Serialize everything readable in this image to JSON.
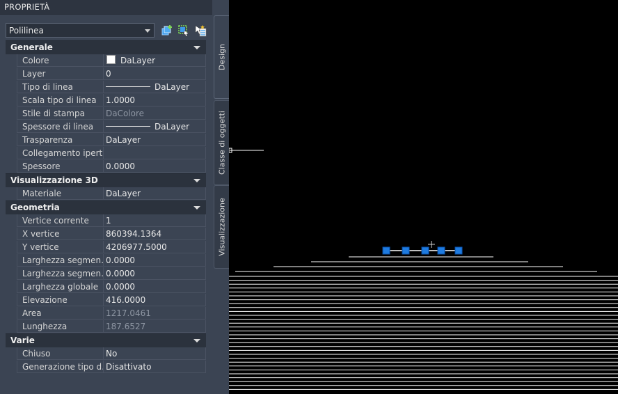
{
  "panel": {
    "title": "PROPRIETÀ",
    "object_selector": {
      "value": "Polilinea"
    },
    "toolbar": [
      {
        "name": "toggle-pickadd-icon"
      },
      {
        "name": "select-objects-icon"
      },
      {
        "name": "quick-select-icon"
      }
    ],
    "tabs": [
      {
        "label": "Design",
        "active": true
      },
      {
        "label": "Classe di oggetti",
        "active": false
      },
      {
        "label": "Visualizzazione",
        "active": false
      }
    ],
    "sections": [
      {
        "title": "Generale",
        "rows": [
          {
            "label": "Colore",
            "value": "DaLayer",
            "kind": "color",
            "swatch": "#ffffff"
          },
          {
            "label": "Layer",
            "value": "0"
          },
          {
            "label": "Tipo di linea",
            "value": "DaLayer",
            "kind": "line"
          },
          {
            "label": "Scala tipo di linea",
            "value": "1.0000"
          },
          {
            "label": "Stile di stampa",
            "value": "DaColore",
            "dim": true
          },
          {
            "label": "Spessore di linea",
            "value": "DaLayer",
            "kind": "line"
          },
          {
            "label": "Trasparenza",
            "value": "DaLayer"
          },
          {
            "label": "Collegamento  ipert…",
            "value": ""
          },
          {
            "label": "Spessore",
            "value": "0.0000"
          }
        ]
      },
      {
        "title": "Visualizzazione 3D",
        "rows": [
          {
            "label": "Materiale",
            "value": "DaLayer"
          }
        ]
      },
      {
        "title": "Geometria",
        "rows": [
          {
            "label": "Vertice corrente",
            "value": "1"
          },
          {
            "label": "X vertice",
            "value": "860394.1364"
          },
          {
            "label": "Y vertice",
            "value": "4206977.5000"
          },
          {
            "label": "Larghezza  segmen…",
            "value": "0.0000"
          },
          {
            "label": "Larghezza  segmen…",
            "value": "0.0000"
          },
          {
            "label": "Larghezza globale",
            "value": "0.0000"
          },
          {
            "label": "Elevazione",
            "value": "416.0000"
          },
          {
            "label": "Area",
            "value": "1217.0461",
            "dim": true
          },
          {
            "label": "Lunghezza",
            "value": "187.6527",
            "dim": true
          }
        ]
      },
      {
        "title": "Varie",
        "rows": [
          {
            "label": "Chiuso",
            "value": "No"
          },
          {
            "label": "Generazione  tipo  d…",
            "value": "Disattivato"
          }
        ]
      }
    ]
  },
  "colors": {
    "panel_bg": "#3b4453",
    "section_bg": "#2b323d",
    "canvas_bg": "#000000",
    "grip": "#1e7be0",
    "contour_line": "#ffffff"
  }
}
